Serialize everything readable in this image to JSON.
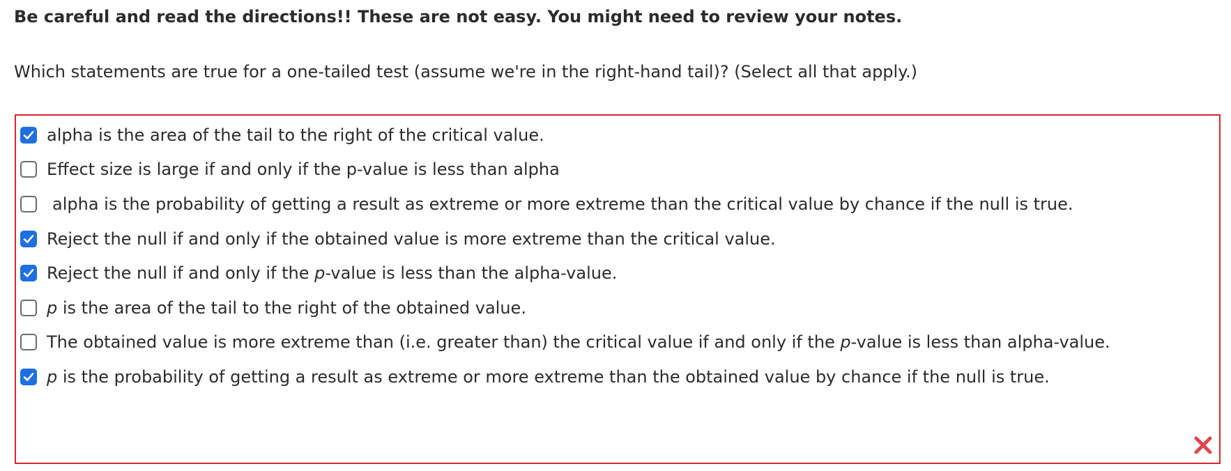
{
  "instruction": "Be careful and read the directions!! These are not easy. You might need to review your notes.",
  "question": "Which statements are true for a one-tailed test (assume we're in the right-hand tail)? (Select all that apply.)",
  "options": [
    {
      "checked": true,
      "text": "alpha is the area of the tail to the right of the critical value."
    },
    {
      "checked": false,
      "text": "Effect size is large if and only if the p-value is less than alpha"
    },
    {
      "checked": false,
      "text": "alpha is the probability of getting a result as extreme or more extreme than the critical value by chance if the null is true."
    },
    {
      "checked": true,
      "text": "Reject the null if and only if the obtained value is more extreme than the critical value."
    },
    {
      "checked": true,
      "pre": "Reject the null if and only if the ",
      "italic": "p",
      "post": "-value is less than the alpha-value."
    },
    {
      "checked": false,
      "italic": "p",
      "post": " is the area of the tail to the right of the obtained value."
    },
    {
      "checked": false,
      "pre": "The obtained value is more extreme than (i.e. greater than) the critical value if and only if the ",
      "italic": "p",
      "post": "-value is less than alpha-value."
    },
    {
      "checked": true,
      "italic": "p",
      "post": " is the probability of getting a result as extreme or more extreme than the obtained value by chance if the null is true."
    }
  ],
  "result_icon": "incorrect-x-icon",
  "colors": {
    "checkbox_checked": "#1e6fe0",
    "answer_border": "#d9262b",
    "incorrect_mark": "#e0464b"
  }
}
